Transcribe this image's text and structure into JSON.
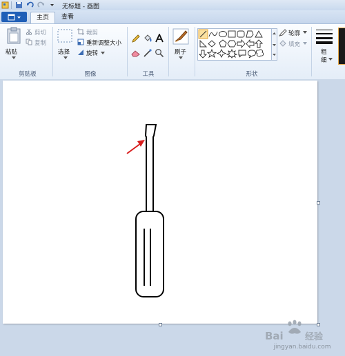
{
  "window": {
    "title": "无标题 - 画图"
  },
  "tabs": [
    {
      "label": "主页",
      "active": true
    },
    {
      "label": "查看",
      "active": false
    }
  ],
  "groups": {
    "clipboard": {
      "label": "剪贴板",
      "paste": "粘贴",
      "cut": "剪切",
      "copy": "复制"
    },
    "image": {
      "label": "图像",
      "select": "选择",
      "crop": "裁剪",
      "resize": "重新调整大小",
      "rotate": "旋转"
    },
    "tools": {
      "label": "工具"
    },
    "brushes": {
      "label": "刷子"
    },
    "shapes": {
      "label": "形状",
      "outline": "轮廓",
      "fill": "填充"
    },
    "size": {
      "label_line1": "粗",
      "label_line2": "细"
    }
  },
  "watermark": {
    "text": "jingyan.baidu.com"
  },
  "colors": {
    "accent": "#1f5fb7",
    "arrow": "#d81e1e"
  }
}
